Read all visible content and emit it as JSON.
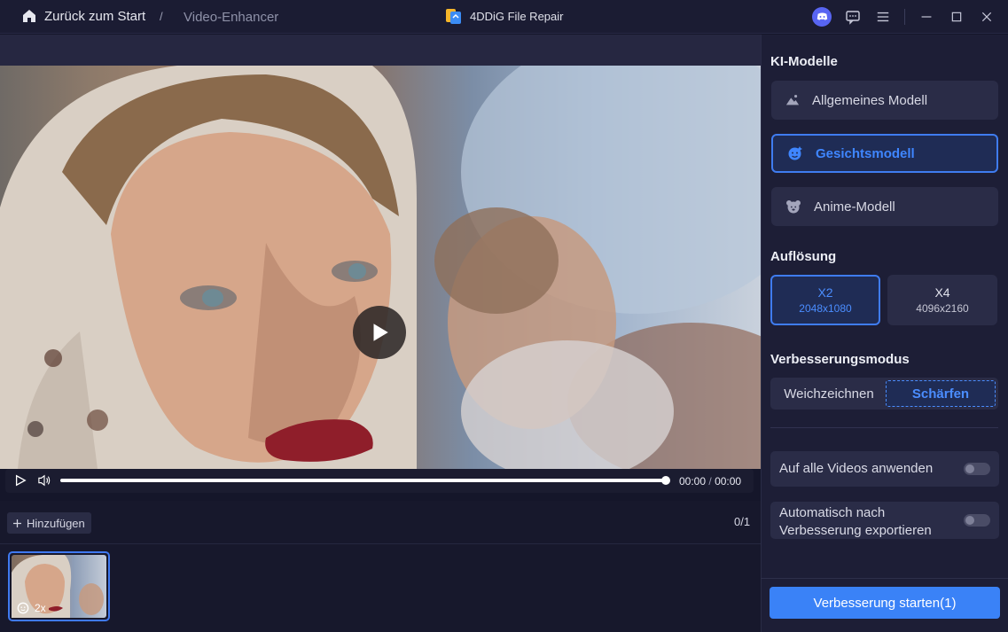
{
  "titlebar": {
    "back_label": "Zurück zum Start",
    "separator": "/",
    "breadcrumb": "Video-Enhancer",
    "app_title": "4DDiG File Repair",
    "icons": [
      "home-icon",
      "discord-icon",
      "feedback-icon",
      "menu-icon",
      "minimize-icon",
      "maximize-icon",
      "close-icon"
    ]
  },
  "player": {
    "current_time": "00:00",
    "time_separator": "/",
    "duration": "00:00",
    "progress": 1.0
  },
  "queue": {
    "add_label": "Hinzufügen",
    "count": "0/1",
    "thumb_badge": "2x"
  },
  "panel": {
    "models_title": "KI-Modelle",
    "models": [
      {
        "label": "Allgemeines Modell",
        "icon": "landscape-icon",
        "active": false
      },
      {
        "label": "Gesichtsmodell",
        "icon": "face-icon",
        "active": true
      },
      {
        "label": "Anime-Modell",
        "icon": "anime-bear-icon",
        "active": false
      }
    ],
    "resolution_title": "Auflösung",
    "resolutions": [
      {
        "main": "X2",
        "sub": "2048x1080",
        "active": true
      },
      {
        "main": "X4",
        "sub": "4096x2160",
        "active": false
      }
    ],
    "mode_title": "Verbesserungsmodus",
    "modes": [
      {
        "label": "Weichzeichnen",
        "active": false
      },
      {
        "label": "Schärfen",
        "active": true
      }
    ],
    "apply_all_label": "Auf alle Videos anwenden",
    "auto_export_line1": "Automatisch nach",
    "auto_export_line2": "Verbesserung exportieren",
    "start_label": "Verbesserung starten(1)"
  },
  "colors": {
    "accent": "#3a82f7",
    "background": "#15162a",
    "panel": "#1d1e36"
  }
}
